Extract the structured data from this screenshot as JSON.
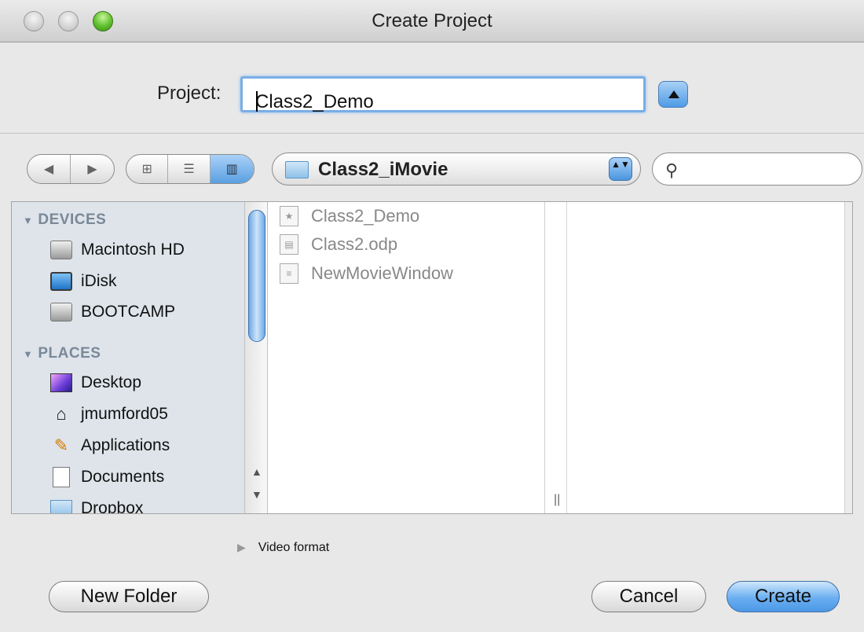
{
  "window": {
    "title": "Create Project"
  },
  "project": {
    "label": "Project:",
    "value": "Class2_Demo"
  },
  "toolbar": {
    "location": "Class2_iMovie",
    "popup_arrows": "▲▼",
    "search_placeholder": ""
  },
  "sidebar": {
    "devices_header": "DEVICES",
    "devices": [
      {
        "label": "Macintosh HD",
        "icon": "hard-drive-icon"
      },
      {
        "label": "iDisk",
        "icon": "idisk-icon"
      },
      {
        "label": "BOOTCAMP",
        "icon": "hard-drive-icon"
      }
    ],
    "places_header": "PLACES",
    "places": [
      {
        "label": "Desktop",
        "icon": "desktop-icon"
      },
      {
        "label": "jmumford05",
        "icon": "home-icon"
      },
      {
        "label": "Applications",
        "icon": "applications-icon"
      },
      {
        "label": "Documents",
        "icon": "documents-icon"
      },
      {
        "label": "Dropbox",
        "icon": "folder-icon"
      }
    ]
  },
  "files": [
    {
      "name": "Class2_Demo",
      "icon": "project-icon"
    },
    {
      "name": "Class2.odp",
      "icon": "presentation-icon"
    },
    {
      "name": "NewMovieWindow",
      "icon": "document-icon"
    }
  ],
  "bottom": {
    "video_format": "Video format",
    "new_folder": "New Folder",
    "cancel": "Cancel",
    "create": "Create"
  }
}
